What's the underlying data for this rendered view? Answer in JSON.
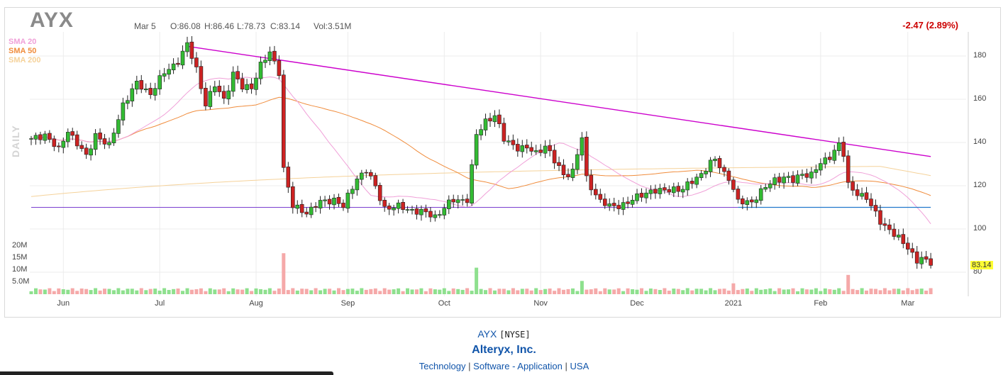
{
  "header": {
    "ticker": "AYX",
    "date": "Mar 5",
    "open": "O:86.08",
    "high": "H:86.46",
    "low": "L:78.73",
    "close": "C:83.14",
    "volume": "Vol:3.51M",
    "change": "-2.47 (2.89%)",
    "period_label": "DAILY"
  },
  "legend": [
    {
      "label": "SMA 20",
      "color": "#f0a0d8"
    },
    {
      "label": "SMA 50",
      "color": "#f08c3c"
    },
    {
      "label": "SMA 200",
      "color": "#f5d29a"
    }
  ],
  "colors": {
    "up": "#33bb33",
    "down": "#cc2222",
    "vol_up": "#8ee08e",
    "vol_down": "#f5a9a9",
    "trendline": "#cc00cc",
    "support": "#2277cc",
    "purple_line": "#7a3fcf",
    "grid": "#ececec"
  },
  "last_price_label": "83.14",
  "footer": {
    "symbol": "AYX",
    "exchange": "[NYSE]",
    "company": "Alteryx, Inc.",
    "sector": "Technology",
    "industry": "Software - Application",
    "country": "USA",
    "separator": "|"
  },
  "chart_data": {
    "type": "candlestick",
    "title": "AYX",
    "y_axis": {
      "range": [
        80,
        186
      ],
      "ticks": [
        80,
        100,
        120,
        140,
        160,
        180
      ],
      "position": "right"
    },
    "volume_axis": {
      "range": [
        0,
        22000000
      ],
      "tick_labels": [
        "20M",
        "15M",
        "10M",
        "5.0M"
      ],
      "tick_values": [
        20000000,
        15000000,
        10000000,
        5000000
      ]
    },
    "x_axis": {
      "labels": [
        "Jun",
        "Jul",
        "Aug",
        "Sep",
        "Oct",
        "Nov",
        "Dec",
        "2021",
        "Feb",
        "Mar"
      ],
      "label_bar_index": [
        7,
        28,
        49,
        69,
        90,
        111,
        132,
        153,
        172,
        191
      ],
      "bar_count": 197
    },
    "anchors": [
      [
        0,
        141
      ],
      [
        3,
        144
      ],
      [
        6,
        136
      ],
      [
        8,
        146
      ],
      [
        12,
        133
      ],
      [
        14,
        144
      ],
      [
        17,
        138
      ],
      [
        20,
        158
      ],
      [
        23,
        167
      ],
      [
        26,
        163
      ],
      [
        29,
        172
      ],
      [
        32,
        178
      ],
      [
        34,
        185
      ],
      [
        36,
        174
      ],
      [
        38,
        158
      ],
      [
        40,
        166
      ],
      [
        42,
        160
      ],
      [
        44,
        172
      ],
      [
        46,
        165
      ],
      [
        48,
        166
      ],
      [
        50,
        176
      ],
      [
        52,
        181
      ],
      [
        54,
        173
      ],
      [
        55,
        128
      ],
      [
        57,
        110
      ],
      [
        60,
        108
      ],
      [
        63,
        112
      ],
      [
        66,
        114
      ],
      [
        68,
        110
      ],
      [
        71,
        124
      ],
      [
        73,
        127
      ],
      [
        75,
        119
      ],
      [
        77,
        110
      ],
      [
        80,
        110
      ],
      [
        83,
        109
      ],
      [
        86,
        107
      ],
      [
        88,
        106
      ],
      [
        90,
        110
      ],
      [
        92,
        113
      ],
      [
        95,
        114
      ],
      [
        97,
        143
      ],
      [
        99,
        150
      ],
      [
        101,
        153
      ],
      [
        103,
        141
      ],
      [
        106,
        138
      ],
      [
        108,
        137
      ],
      [
        110,
        135
      ],
      [
        112,
        139
      ],
      [
        114,
        131
      ],
      [
        116,
        125
      ],
      [
        118,
        127
      ],
      [
        120,
        142
      ],
      [
        121,
        123
      ],
      [
        124,
        113
      ],
      [
        126,
        110
      ],
      [
        128,
        111
      ],
      [
        131,
        113
      ],
      [
        133,
        116
      ],
      [
        135,
        118
      ],
      [
        137,
        117
      ],
      [
        140,
        119
      ],
      [
        142,
        118
      ],
      [
        145,
        124
      ],
      [
        147,
        128
      ],
      [
        149,
        132
      ],
      [
        151,
        126
      ],
      [
        152,
        124
      ],
      [
        154,
        112
      ],
      [
        157,
        113
      ],
      [
        160,
        119
      ],
      [
        162,
        123
      ],
      [
        164,
        124
      ],
      [
        166,
        122
      ],
      [
        168,
        126
      ],
      [
        170,
        125
      ],
      [
        172,
        130
      ],
      [
        174,
        134
      ],
      [
        176,
        139
      ],
      [
        177,
        134
      ],
      [
        178,
        120
      ],
      [
        180,
        117
      ],
      [
        182,
        114
      ],
      [
        183,
        110
      ],
      [
        185,
        104
      ],
      [
        188,
        97
      ],
      [
        191,
        92
      ],
      [
        193,
        85
      ],
      [
        194,
        86
      ],
      [
        196,
        83.14
      ]
    ],
    "volume_spikes": [
      {
        "bar": 55,
        "value": 17000000
      },
      {
        "bar": 97,
        "value": 11000000
      },
      {
        "bar": 120,
        "value": 5500000
      },
      {
        "bar": 153,
        "value": 4500000
      },
      {
        "bar": 178,
        "value": 8000000
      }
    ],
    "overlays": {
      "resistance_trendline": [
        [
          34,
          184.5
        ],
        [
          196,
          133.5
        ]
      ],
      "support_line": {
        "from_bar": 154,
        "to_bar": 196,
        "value": 110
      },
      "horizontal_line": {
        "from_bar": 0,
        "to_bar": 154,
        "value": 110
      }
    },
    "last_price": 83.14
  }
}
